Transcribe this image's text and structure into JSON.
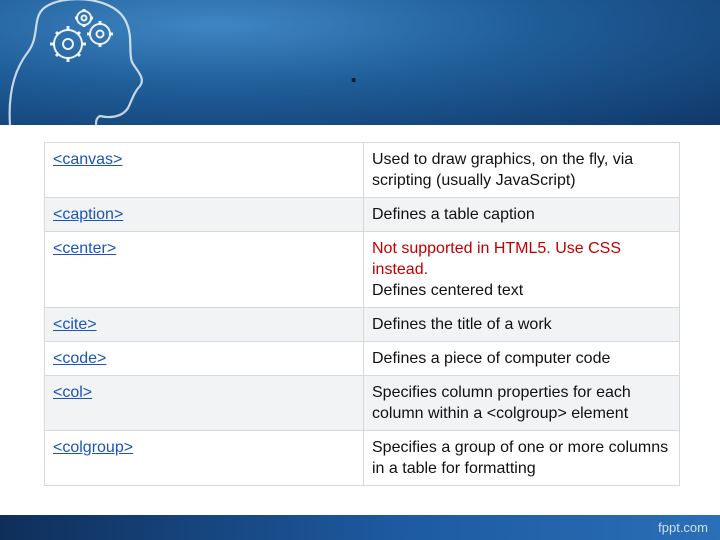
{
  "slide": {
    "title": ".",
    "footer_brand": "fppt.com"
  },
  "colors": {
    "banner": "#1f5d98",
    "link": "#1a55b8",
    "note": "#c00000",
    "footer": "#1d5aa0"
  },
  "icons": {
    "banner": "head-with-gears-icon"
  },
  "rows": [
    {
      "tag": "<canvas>",
      "description": "Used to draw graphics, on the fly, via scripting (usually JavaScript)",
      "note": ""
    },
    {
      "tag": "<caption>",
      "description": "Defines a table caption",
      "note": ""
    },
    {
      "tag": "<center>",
      "description": "Defines centered text",
      "note": "Not supported in HTML5. Use CSS instead."
    },
    {
      "tag": "<cite>",
      "description": "Defines the title of a work",
      "note": ""
    },
    {
      "tag": "<code>",
      "description": "Defines a piece of computer code",
      "note": ""
    },
    {
      "tag": "<col>",
      "description": "Specifies column properties for each column within a <colgroup> element",
      "note": ""
    },
    {
      "tag": "<colgroup>",
      "description": "Specifies a group of one or more columns in a table for formatting",
      "note": ""
    }
  ]
}
